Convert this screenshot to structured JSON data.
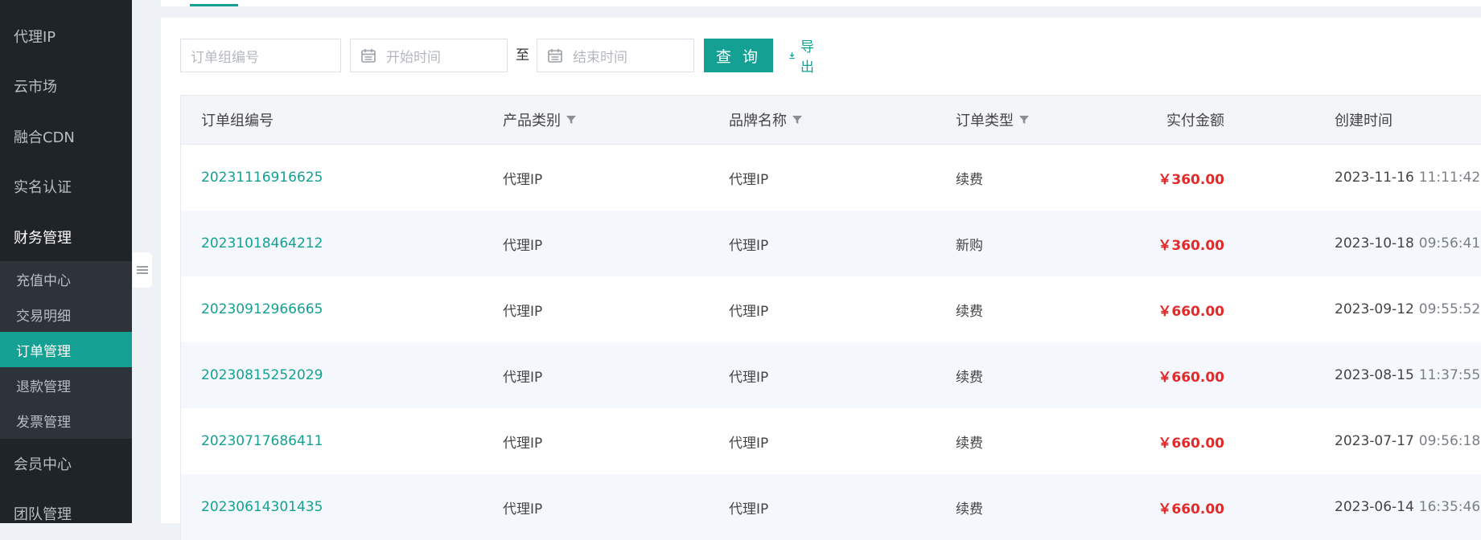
{
  "colors": {
    "accent": "#14a193",
    "amount": "#e02b2b",
    "sidebar_bg": "#1f2428"
  },
  "sidebar": {
    "items": [
      {
        "label": "代理IP"
      },
      {
        "label": "云市场"
      },
      {
        "label": "融合CDN"
      },
      {
        "label": "实名认证"
      },
      {
        "label": "财务管理"
      }
    ],
    "submenu": [
      {
        "label": "充值中心"
      },
      {
        "label": "交易明细"
      },
      {
        "label": "订单管理"
      },
      {
        "label": "退款管理"
      },
      {
        "label": "发票管理"
      }
    ],
    "items_after": [
      {
        "label": "会员中心"
      },
      {
        "label": "团队管理"
      }
    ]
  },
  "filters": {
    "order_placeholder": "订单组编号",
    "start_placeholder": "开始时间",
    "end_placeholder": "结束时间",
    "range_sep": "至",
    "query_label": "查 询",
    "export_label": "导出",
    "calendar_icon": "calendar-icon",
    "export_icon": "download-icon"
  },
  "table": {
    "headers": [
      "订单组编号",
      "产品类别",
      "品牌名称",
      "订单类型",
      "实付金额",
      "创建时间"
    ],
    "rows": [
      {
        "order_id": "20231116916625",
        "category": "代理IP",
        "brand": "代理IP",
        "type": "续费",
        "amount": "￥360.00",
        "date": "2023-11-16",
        "time": "11:11:42"
      },
      {
        "order_id": "20231018464212",
        "category": "代理IP",
        "brand": "代理IP",
        "type": "新购",
        "amount": "￥360.00",
        "date": "2023-10-18",
        "time": "09:56:41"
      },
      {
        "order_id": "20230912966665",
        "category": "代理IP",
        "brand": "代理IP",
        "type": "续费",
        "amount": "￥660.00",
        "date": "2023-09-12",
        "time": "09:55:52"
      },
      {
        "order_id": "20230815252029",
        "category": "代理IP",
        "brand": "代理IP",
        "type": "续费",
        "amount": "￥660.00",
        "date": "2023-08-15",
        "time": "11:37:55"
      },
      {
        "order_id": "20230717686411",
        "category": "代理IP",
        "brand": "代理IP",
        "type": "续费",
        "amount": "￥660.00",
        "date": "2023-07-17",
        "time": "09:56:18"
      },
      {
        "order_id": "20230614301435",
        "category": "代理IP",
        "brand": "代理IP",
        "type": "续费",
        "amount": "￥660.00",
        "date": "2023-06-14",
        "time": "16:35:46"
      }
    ]
  }
}
